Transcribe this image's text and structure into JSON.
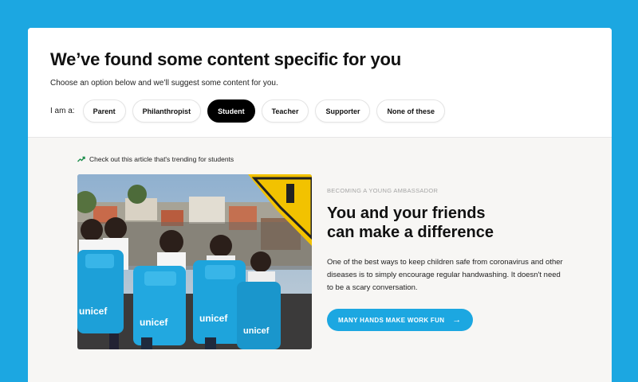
{
  "header": {
    "title": "We’ve found some content specific for you",
    "subtitle": "Choose an option below and we’ll suggest some content for you.",
    "role_label": "I am a:",
    "roles": [
      {
        "label": "Parent",
        "active": false
      },
      {
        "label": "Philanthropist",
        "active": false
      },
      {
        "label": "Student",
        "active": true
      },
      {
        "label": "Teacher",
        "active": false
      },
      {
        "label": "Supporter",
        "active": false
      },
      {
        "label": "None of these",
        "active": false
      }
    ]
  },
  "trending": {
    "icon": "trending-up-icon",
    "text": "Check out this article that's trending for students"
  },
  "photo": {
    "bag_logo_text": "unicef"
  },
  "article": {
    "eyebrow": "BECOMING A YOUNG AMBASSADOR",
    "title_line1": "You and your friends",
    "title_line2": "can make a difference",
    "body": "One of the best ways to keep children safe from coronavirus and other diseases is to simply encourage regular handwashing. It doesn't need to be a scary conversation.",
    "cta_label": "MANY HANDS MAKE WORK FUN",
    "cta_icon": "arrow-right-icon"
  },
  "colors": {
    "brand_blue": "#1ca7e1",
    "active_pill": "#000000"
  }
}
